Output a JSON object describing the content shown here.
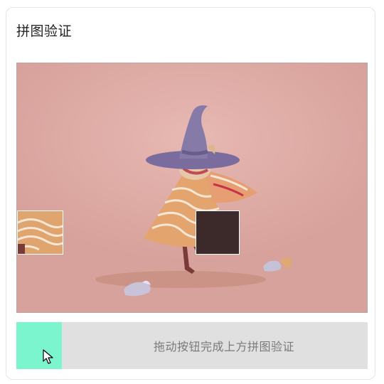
{
  "captcha": {
    "title": "拼图验证",
    "slider_hint": "拖动按钮完成上方拼图验证",
    "slider_progress_fraction": 0.13
  },
  "colors": {
    "background_pink": "#deaaa4",
    "slider_fill": "#7bf5cd",
    "slider_track": "#e0e0e0",
    "hole": "#3c2a2a",
    "hat": "#7a6c9c"
  },
  "icons": {
    "cursor": "mouse-pointer-icon"
  }
}
